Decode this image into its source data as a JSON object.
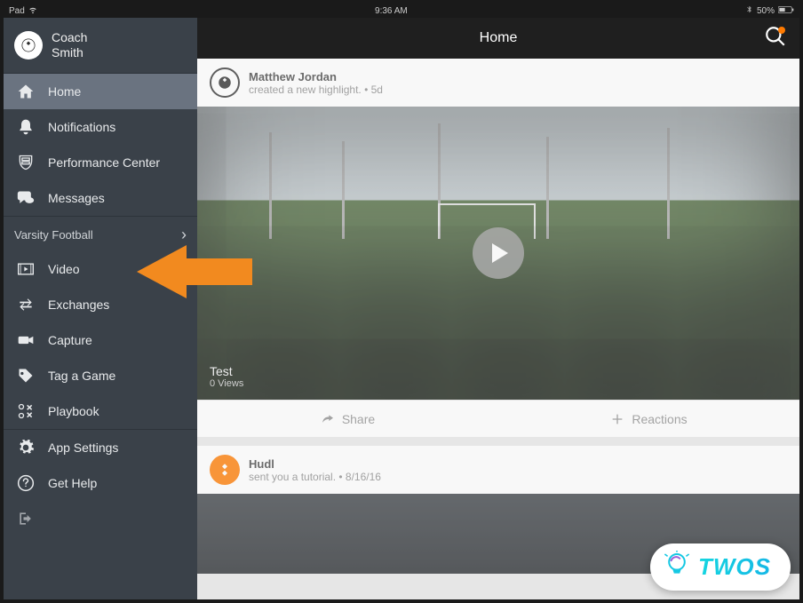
{
  "status_bar": {
    "device": "Pad",
    "wifi_icon": "wifi-icon",
    "time": "9:36 AM",
    "bluetooth_icon": "bluetooth-icon",
    "battery_pct": "50%"
  },
  "user": {
    "line1": "Coach",
    "line2": "Smith"
  },
  "nav": {
    "home": "Home",
    "notifications": "Notifications",
    "performance_center": "Performance Center",
    "messages": "Messages"
  },
  "team_section": {
    "label": "Varsity Football",
    "video": "Video",
    "exchanges": "Exchanges",
    "capture": "Capture",
    "tag_game": "Tag a Game",
    "playbook": "Playbook"
  },
  "bottom_nav": {
    "app_settings": "App Settings",
    "get_help": "Get Help"
  },
  "header": {
    "title": "Home"
  },
  "feed": {
    "card1": {
      "author": "Matthew Jordan",
      "subtitle": "created a new highlight. • 5d",
      "video_title": "Test",
      "video_views": "0 Views",
      "share_label": "Share",
      "reactions_label": "Reactions"
    },
    "card2": {
      "author": "Hudl",
      "subtitle": "sent you a tutorial. • 8/16/16"
    }
  },
  "watermark": {
    "text": "TWOS"
  }
}
